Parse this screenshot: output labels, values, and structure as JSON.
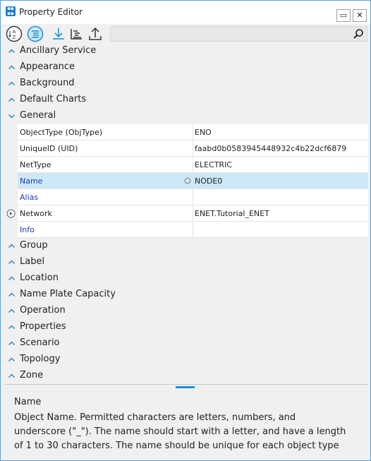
{
  "window": {
    "title": "Property Editor",
    "minimize_glyph": "▭",
    "close_glyph": "✕"
  },
  "toolbar": {
    "icons": [
      "sort-alphabetical-icon",
      "categorized-icon",
      "download-icon",
      "hierarchy-icon",
      "upload-icon",
      "search-icon"
    ],
    "search_placeholder": ""
  },
  "categories_before": [
    {
      "label": "Ancillary Service",
      "expanded": false
    },
    {
      "label": "Appearance",
      "expanded": false
    },
    {
      "label": "Background",
      "expanded": false
    },
    {
      "label": "Default Charts",
      "expanded": false
    },
    {
      "label": "General",
      "expanded": true
    }
  ],
  "general_properties": [
    {
      "name": "ObjectType (ObjType)",
      "value": "ENO"
    },
    {
      "name": "UniqueID (UID)",
      "value": "faabd0b0583945448932c4b22dcf6879"
    },
    {
      "name": "NetType",
      "value": "ELECTRIC"
    },
    {
      "name": "Name",
      "value": "NODE0",
      "selected": true
    },
    {
      "name": "Alias",
      "value": ""
    },
    {
      "name": "Network",
      "value": "ENET.Tutorial_ENET"
    },
    {
      "name": "Info",
      "value": ""
    }
  ],
  "categories_after": [
    {
      "label": "Group"
    },
    {
      "label": "Label"
    },
    {
      "label": "Location"
    },
    {
      "label": "Name Plate Capacity"
    },
    {
      "label": "Operation"
    },
    {
      "label": "Properties"
    },
    {
      "label": "Scenario"
    },
    {
      "label": "Topology"
    },
    {
      "label": "Zone"
    }
  ],
  "description": {
    "title": "Name",
    "line1": "Object Name. Permitted characters are letters, numbers, and",
    "line2": "underscore (\"_\"). The name should start with a letter, and have a length",
    "line3": "of 1 to 30 characters. The name should be unique for each object type"
  },
  "colors": {
    "accent": "#1e90d6",
    "selection": "#cce8f6",
    "link_text": "#1a3fb0"
  }
}
